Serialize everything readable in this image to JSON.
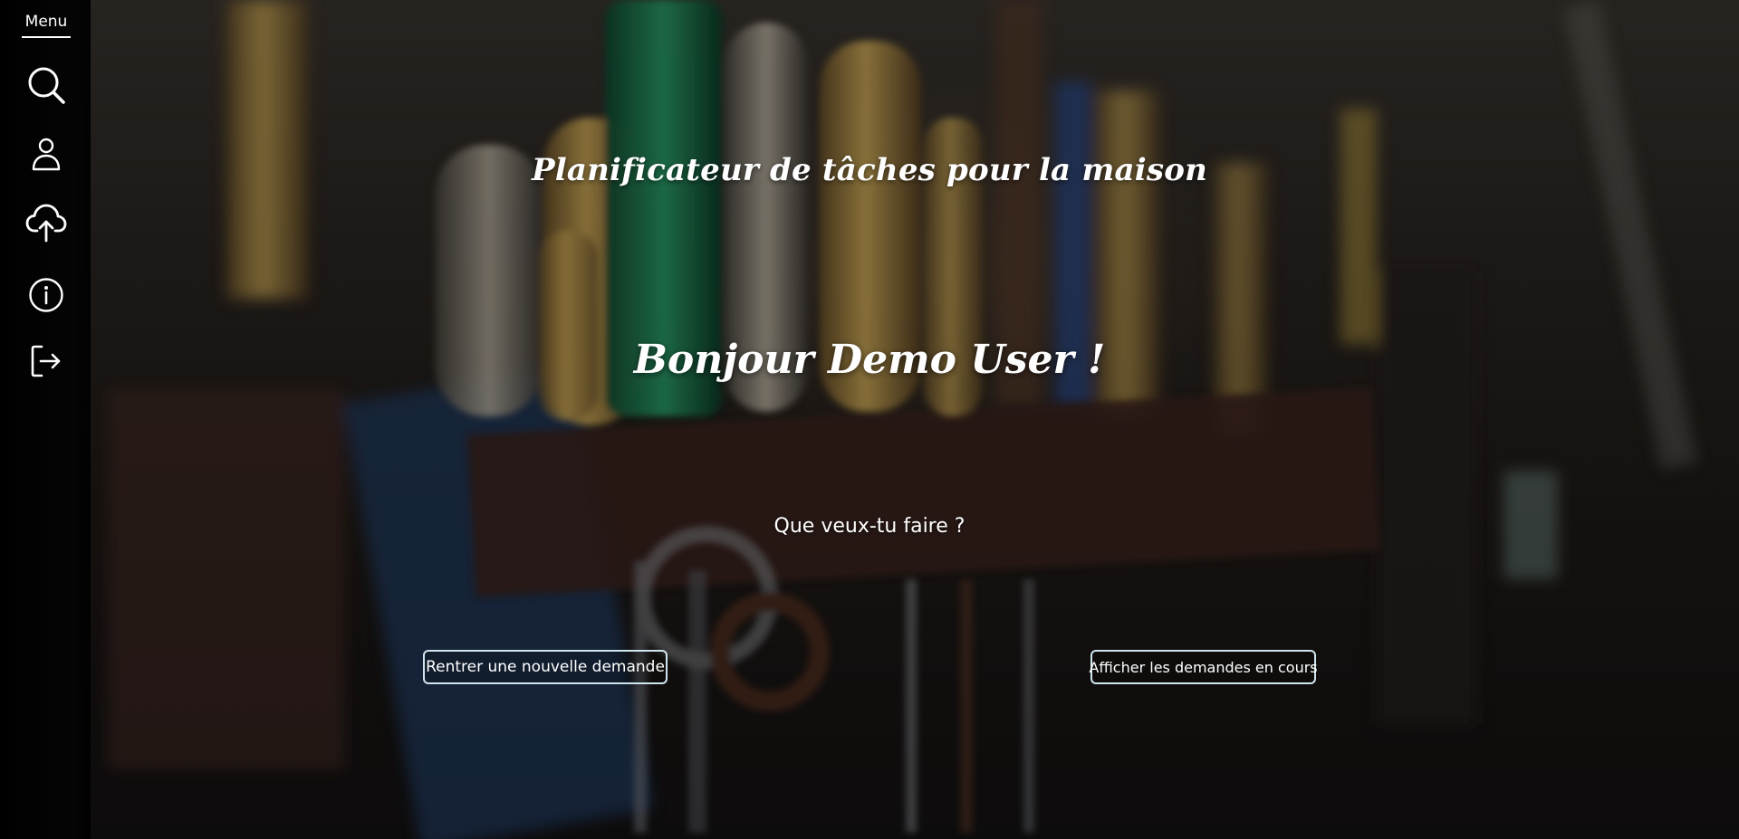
{
  "sidebar": {
    "menu_label": "Menu",
    "items": [
      {
        "icon": "search-icon",
        "name": "sidebar-item-search"
      },
      {
        "icon": "user-icon",
        "name": "sidebar-item-profile"
      },
      {
        "icon": "cloud-upload-icon",
        "name": "sidebar-item-upload"
      },
      {
        "icon": "info-icon",
        "name": "sidebar-item-info"
      },
      {
        "icon": "logout-icon",
        "name": "sidebar-item-logout"
      }
    ]
  },
  "main": {
    "title": "Planificateur de tâches pour la maison",
    "greeting": "Bonjour Demo User !",
    "question": "Que veux-tu faire ?",
    "new_request_label": "Rentrer une nouvelle demande",
    "show_requests_label": "Afficher les demandes en cours"
  },
  "colors": {
    "sidebar_bg": "#000000",
    "text": "#ffffff",
    "button_border": "#cfe6ee"
  }
}
